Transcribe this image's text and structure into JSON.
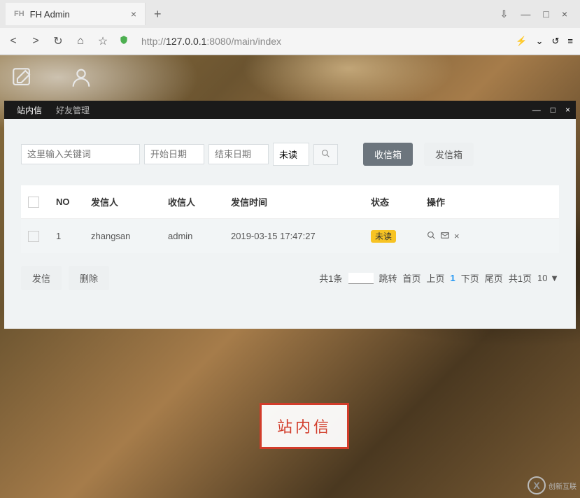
{
  "browser": {
    "tab_title": "FH Admin",
    "tab_favicon_label": "FH",
    "new_tab": "+",
    "window_minimize": "—",
    "window_maximize": "□",
    "window_close": "×",
    "url_prefix": "http://",
    "url_host": "127.0.0.1",
    "url_port_path": ":8080/main/index",
    "nav_back": "<",
    "nav_forward": ">",
    "nav_reload": "↻",
    "nav_home": "⌂",
    "nav_star": "☆",
    "nav_download": "⇩",
    "nav_refresh_menu": "↺",
    "nav_menu": "≡"
  },
  "modal": {
    "tab_inbox": "站内信",
    "tab_friends": "好友管理",
    "minimize": "—",
    "maximize": "□",
    "close": "×"
  },
  "filters": {
    "keyword_placeholder": "这里输入关键词",
    "start_date_placeholder": "开始日期",
    "end_date_placeholder": "结束日期",
    "status_value": "未读",
    "search_icon": "🔍",
    "inbox_btn": "收信箱",
    "outbox_btn": "发信箱"
  },
  "table": {
    "headers": {
      "no": "NO",
      "sender": "发信人",
      "receiver": "收信人",
      "send_time": "发信时间",
      "status": "状态",
      "operate": "操作"
    },
    "rows": [
      {
        "no": "1",
        "sender": "zhangsan",
        "receiver": "admin",
        "send_time": "2019-03-15 17:47:27",
        "status": "未读"
      }
    ]
  },
  "actions": {
    "send": "发信",
    "delete": "删除"
  },
  "pagination": {
    "total_text": "共1条",
    "jump_label": "跳转",
    "first": "首页",
    "prev": "上页",
    "current": "1",
    "next": "下页",
    "last": "尾页",
    "total_pages": "共1页",
    "page_size": "10 ▼"
  },
  "callout": {
    "text": "站内信"
  },
  "watermark": {
    "logo": "X",
    "text": "创新互联"
  }
}
